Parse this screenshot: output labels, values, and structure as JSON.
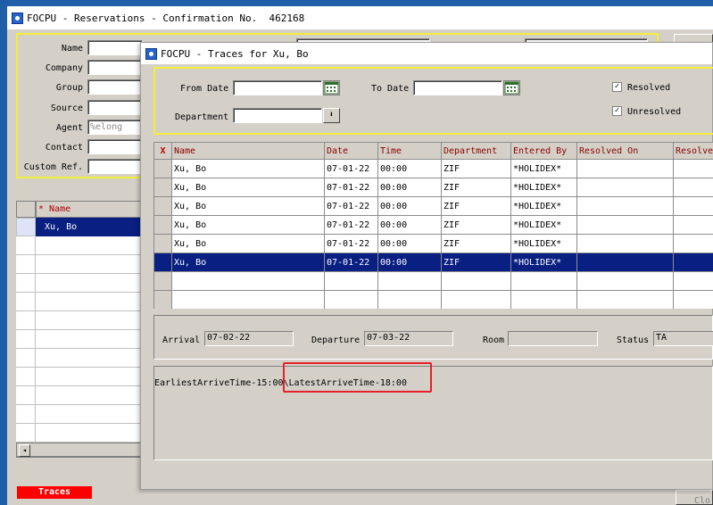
{
  "main_window": {
    "title": "FOCPU - Reservations - Confirmation No.  462168",
    "labels": {
      "name": "Name",
      "company": "Company",
      "group": "Group",
      "source": "Source",
      "agent": "Agent",
      "contact": "Contact",
      "custom_ref": "Custom Ref."
    },
    "agent_placeholder": "%elong",
    "guest_list_header": "* Name",
    "guest_list": [
      "Xu, Bo"
    ],
    "traces_button": "Traces",
    "close_button": "Clo"
  },
  "traces_window": {
    "title": "FOCPU - Traces for Xu, Bo",
    "filters": {
      "from_date_label": "From Date",
      "to_date_label": "To Date",
      "department_label": "Department",
      "resolved_label": "Resolved",
      "unresolved_label": "Unresolved",
      "resolved_checked": true,
      "unresolved_checked": true
    },
    "table": {
      "columns": [
        "X",
        "Name",
        "Date",
        "Time",
        "Department",
        "Entered By",
        "Resolved On",
        "Resolve"
      ],
      "rows": [
        [
          "",
          "Xu, Bo",
          "07-01-22",
          "00:00",
          "ZIF",
          "*HOLIDEX*",
          "",
          ""
        ],
        [
          "",
          "Xu, Bo",
          "07-01-22",
          "00:00",
          "ZIF",
          "*HOLIDEX*",
          "",
          ""
        ],
        [
          "",
          "Xu, Bo",
          "07-01-22",
          "00:00",
          "ZIF",
          "*HOLIDEX*",
          "",
          ""
        ],
        [
          "",
          "Xu, Bo",
          "07-01-22",
          "00:00",
          "ZIF",
          "*HOLIDEX*",
          "",
          ""
        ],
        [
          "",
          "Xu, Bo",
          "07-01-22",
          "00:00",
          "ZIF",
          "*HOLIDEX*",
          "",
          ""
        ],
        [
          "",
          "Xu, Bo",
          "07-01-22",
          "00:00",
          "ZIF",
          "*HOLIDEX*",
          "",
          ""
        ],
        [
          "",
          "",
          "",
          "",
          "",
          "",
          "",
          ""
        ],
        [
          "",
          "",
          "",
          "",
          "",
          "",
          "",
          ""
        ]
      ],
      "selected_row": 5
    },
    "details": {
      "arrival_label": "Arrival",
      "arrival_value": "07-02-22",
      "departure_label": "Departure",
      "departure_value": "07-03-22",
      "room_label": "Room",
      "room_value": "",
      "status_label": "Status",
      "status_value": "TA"
    },
    "trace_text": "EarliestArriveTime-15:00\\LatestArriveTime-18:00"
  },
  "colors": {
    "desktop": "#1f5fa8",
    "selection": "#0a1f82",
    "highlight_box": "#e8202a",
    "yellow_frame": "#f2ee3a"
  }
}
